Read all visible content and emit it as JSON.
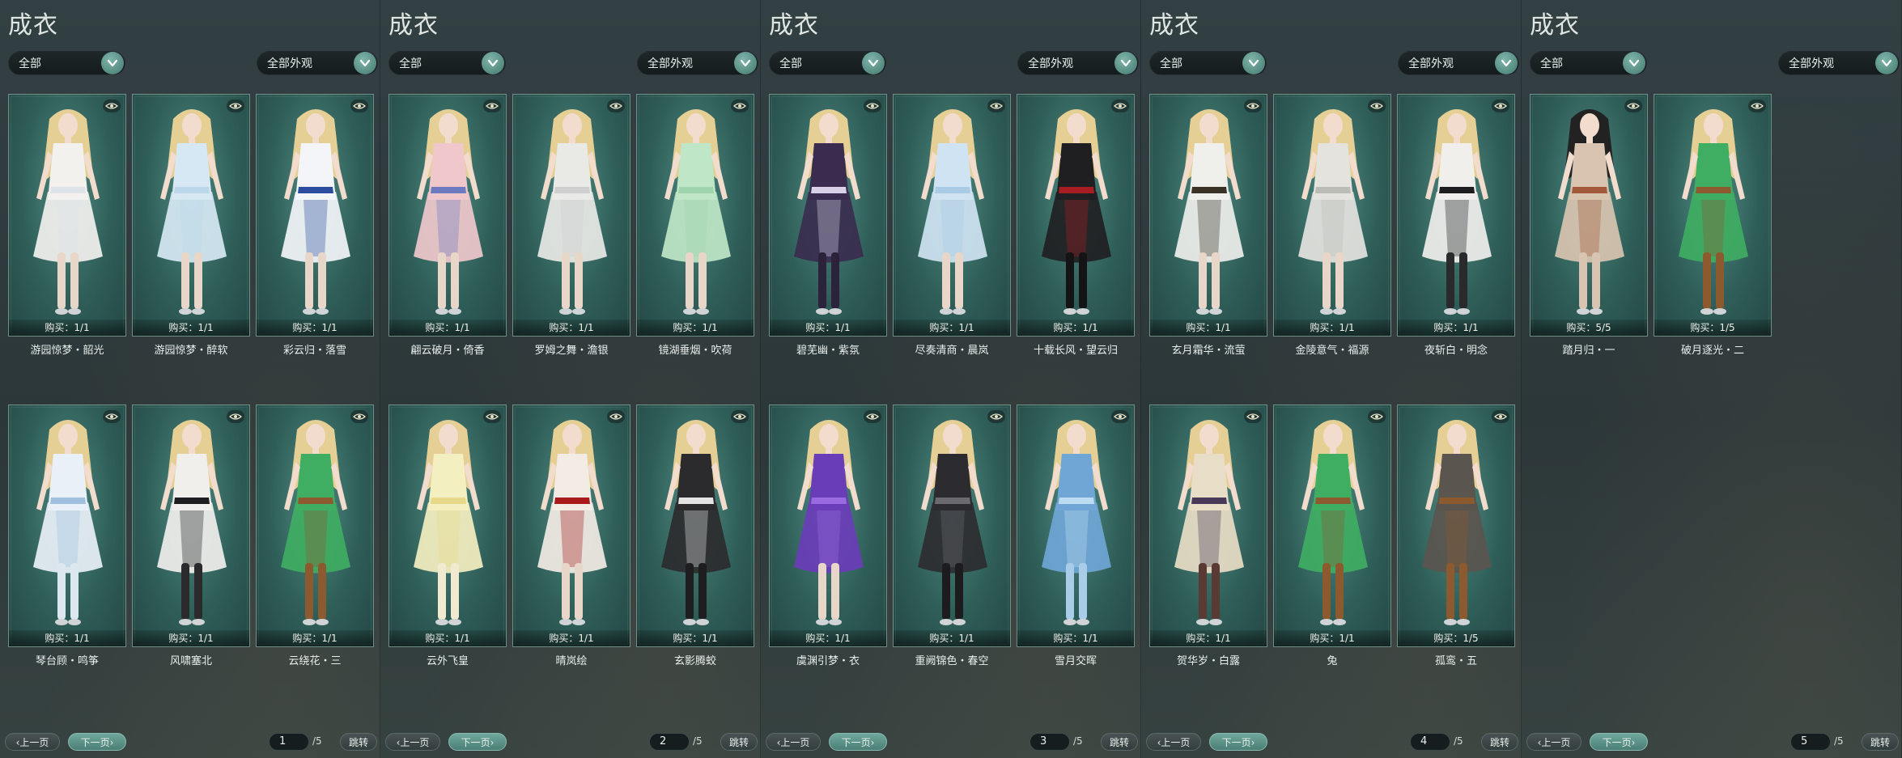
{
  "panels": [
    {
      "title": "成衣",
      "filter_left": "全部",
      "filter_right": "全部外观",
      "page": "1",
      "total": "/5",
      "prev_label": "上一页",
      "next_label": "下一页",
      "jump_label": "跳转",
      "items": [
        {
          "name": "游园惊梦・韶光",
          "buy": "购买：1/1",
          "palette": "white"
        },
        {
          "name": "游园惊梦・醉软",
          "buy": "购买：1/1",
          "palette": "lightblue"
        },
        {
          "name": "彩云归・落雪",
          "buy": "购买：1/1",
          "palette": "whiteblue"
        },
        {
          "name": "琴台顾・鸣筝",
          "buy": "购买：1/1",
          "palette": "icewhite"
        },
        {
          "name": "风啸塞北",
          "buy": "购买：1/1",
          "palette": "whiteblack"
        },
        {
          "name": "云绕花・三",
          "buy": "购买：1/1",
          "palette": "green"
        }
      ]
    },
    {
      "title": "成衣",
      "filter_left": "全部",
      "filter_right": "全部外观",
      "page": "2",
      "total": "/5",
      "prev_label": "上一页",
      "next_label": "下一页",
      "jump_label": "跳转",
      "items": [
        {
          "name": "翩云破月・倚香",
          "buy": "购买：1/1",
          "palette": "pink"
        },
        {
          "name": "罗姆之舞・澹银",
          "buy": "购买：1/1",
          "palette": "silver"
        },
        {
          "name": "镜湖垂烟・吹荷",
          "buy": "购买：1/1",
          "palette": "mint"
        },
        {
          "name": "云外飞皇",
          "buy": "购买：1/1",
          "palette": "yellow"
        },
        {
          "name": "晴岚绘",
          "buy": "购买：1/1",
          "palette": "red"
        },
        {
          "name": "玄影腾蛟",
          "buy": "购买：1/1",
          "palette": "blackwhite"
        }
      ]
    },
    {
      "title": "成衣",
      "filter_left": "全部",
      "filter_right": "全部外观",
      "page": "3",
      "total": "/5",
      "prev_label": "上一页",
      "next_label": "下一页",
      "jump_label": "跳转",
      "items": [
        {
          "name": "碧芜幽・紫氛",
          "buy": "购买：1/1",
          "palette": "darkpurple"
        },
        {
          "name": "尽奏清商・晨岚",
          "buy": "购买：1/1",
          "palette": "paleblue"
        },
        {
          "name": "十载长风・望云归",
          "buy": "购买：1/1",
          "palette": "blackred"
        },
        {
          "name": "虞渊引梦・衣",
          "buy": "购买：1/1",
          "palette": "violet"
        },
        {
          "name": "重阙锦色・春空",
          "buy": "购买：1/1",
          "palette": "charcoal"
        },
        {
          "name": "雪月交晖",
          "buy": "购买：1/1",
          "palette": "sky"
        }
      ]
    },
    {
      "title": "成衣",
      "filter_left": "全部",
      "filter_right": "全部外观",
      "page": "4",
      "total": "/5",
      "prev_label": "上一页",
      "next_label": "下一页",
      "jump_label": "跳转",
      "items": [
        {
          "name": "玄月霜华・流萤",
          "buy": "购买：1/1",
          "palette": "whitewing"
        },
        {
          "name": "金陵意气・福源",
          "buy": "购买：1/1",
          "palette": "grey"
        },
        {
          "name": "夜斩白・明念",
          "buy": "购买：1/1",
          "palette": "whiteblack"
        },
        {
          "name": "贺华岁・白露",
          "buy": "购买：1/1",
          "palette": "cream"
        },
        {
          "name": "兔",
          "buy": "购买：1/1",
          "palette": "green"
        },
        {
          "name": "孤鸾・五",
          "buy": "购买：1/5",
          "palette": "dark"
        }
      ]
    },
    {
      "title": "成衣",
      "filter_left": "全部",
      "filter_right": "全部外观",
      "page": "5",
      "total": "/5",
      "prev_label": "上一页",
      "next_label": "下一页",
      "jump_label": "跳转",
      "items": [
        {
          "name": "踏月归・一",
          "buy": "购买：5/5",
          "palette": "beige"
        },
        {
          "name": "破月逐光・二",
          "buy": "购买：1/5",
          "palette": "green"
        }
      ]
    }
  ],
  "palettes": {
    "white": {
      "dress": "#f2f1ee",
      "accent": "#dfe3ea",
      "hair": "#e6cf95",
      "legs": "#e8d6c8"
    },
    "lightblue": {
      "dress": "#d6e8f3",
      "accent": "#bcd6ea",
      "hair": "#e6cf95",
      "legs": "#e8d6c8"
    },
    "whiteblue": {
      "dress": "#f3f5f8",
      "accent": "#2b4da0",
      "hair": "#e6cf95",
      "legs": "#e8d6c8"
    },
    "icewhite": {
      "dress": "#e9f0f7",
      "accent": "#9fc0df",
      "hair": "#e6cf95",
      "legs": "#dde7f0"
    },
    "whiteblack": {
      "dress": "#f0efeb",
      "accent": "#1e1e20",
      "hair": "#e6cf95",
      "legs": "#2a2a2c"
    },
    "green": {
      "dress": "#3fae63",
      "accent": "#8c5a2e",
      "hair": "#e6cf95",
      "legs": "#8c5a2e"
    },
    "pink": {
      "dress": "#f0c8cc",
      "accent": "#6e7ac0",
      "hair": "#e6cf95",
      "legs": "#e8d6c8"
    },
    "silver": {
      "dress": "#e9e9e6",
      "accent": "#cfcfcf",
      "hair": "#e6cf95",
      "legs": "#e8d6c8"
    },
    "mint": {
      "dress": "#bfe6c7",
      "accent": "#9fd4ad",
      "hair": "#e6cf95",
      "legs": "#e8d6c8"
    },
    "yellow": {
      "dress": "#f4efc0",
      "accent": "#e8d98a",
      "hair": "#e6cf95",
      "legs": "#f1ead0"
    },
    "red": {
      "dress": "#f2ece4",
      "accent": "#a8191c",
      "hair": "#e6cf95",
      "legs": "#e8d6c8"
    },
    "blackwhite": {
      "dress": "#2b2b2e",
      "accent": "#e4e4e4",
      "hair": "#e6cf95",
      "legs": "#1e1e20"
    },
    "darkpurple": {
      "dress": "#3a2c4e",
      "accent": "#d8d0e8",
      "hair": "#e6cf95",
      "legs": "#2c223c"
    },
    "paleblue": {
      "dress": "#cfe3f2",
      "accent": "#a9cbe6",
      "hair": "#e6cf95",
      "legs": "#e8d6c8"
    },
    "blackred": {
      "dress": "#1f1f22",
      "accent": "#a81d22",
      "hair": "#e6cf95",
      "legs": "#141416"
    },
    "violet": {
      "dress": "#6a3db8",
      "accent": "#9a6ae0",
      "hair": "#e6cf95",
      "legs": "#e8d6c8"
    },
    "charcoal": {
      "dress": "#2c2c30",
      "accent": "#6a6a70",
      "hair": "#e6cf95",
      "legs": "#1c1c1e"
    },
    "sky": {
      "dress": "#6fa6d6",
      "accent": "#bcdcf2",
      "hair": "#e6cf95",
      "legs": "#a9cce8"
    },
    "whitewing": {
      "dress": "#efefec",
      "accent": "#3a3226",
      "hair": "#e6cf95",
      "legs": "#e8d6c8"
    },
    "grey": {
      "dress": "#e4e3de",
      "accent": "#bcbcb6",
      "hair": "#e6cf95",
      "legs": "#e8d6c8"
    },
    "cream": {
      "dress": "#e8ddc6",
      "accent": "#4a3a5a",
      "hair": "#e6cf95",
      "legs": "#5a3a34"
    },
    "dark": {
      "dress": "#5a554f",
      "accent": "#8c5a2e",
      "hair": "#e6cf95",
      "legs": "#8c5a2e"
    },
    "beige": {
      "dress": "#d8c4b0",
      "accent": "#a25a3a",
      "hair": "#222222",
      "legs": "#d8c4b0"
    }
  }
}
